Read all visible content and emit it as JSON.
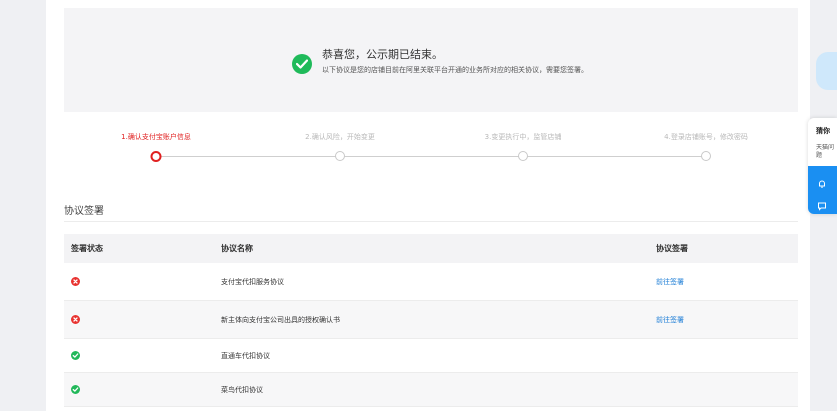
{
  "notice": {
    "title": "恭喜您，公示期已结束。",
    "subtitle": "以下协议是您的店铺目前在阿里关联平台开通的业务所对应的相关协议，需要您签署。"
  },
  "steps": [
    {
      "label": "1.确认支付宝账户信息",
      "active": true
    },
    {
      "label": "2.确认风险，开始变更",
      "active": false
    },
    {
      "label": "3.变更执行中，监管店铺",
      "active": false
    },
    {
      "label": "4.登录店铺账号，修改密码",
      "active": false
    }
  ],
  "section": {
    "title": "协议签署"
  },
  "table": {
    "headers": {
      "status": "签署状态",
      "name": "协议名称",
      "action": "协议签署"
    },
    "rows": [
      {
        "status": "error",
        "name": "支付宝代扣服务协议",
        "action": "前往签署"
      },
      {
        "status": "error",
        "name": "新主体向支付宝公司出具的授权确认书",
        "action": "前往签署"
      },
      {
        "status": "ok",
        "name": "直通车代扣协议",
        "action": ""
      },
      {
        "status": "ok",
        "name": "菜鸟代扣协议",
        "action": ""
      }
    ]
  },
  "side_panel": {
    "title": "猜你",
    "text": "天猫问题",
    "icons": [
      "bell-icon",
      "chat-icon"
    ]
  },
  "colors": {
    "accent_red": "#e02020",
    "success_green": "#1fba5a",
    "link_blue": "#1e7ed6",
    "panel_blue": "#1a8ff2"
  }
}
